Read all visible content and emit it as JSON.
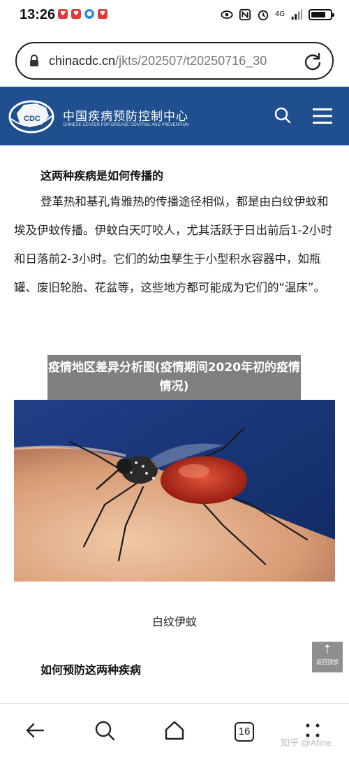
{
  "status_bar": {
    "time": "13:26",
    "network": "4G"
  },
  "browser": {
    "url_domain": "chinacdc.cn",
    "url_path": "/jkts/202507/t20250716_30"
  },
  "site_header": {
    "logo_text": "CDC",
    "title": "中国疾病预防控制中心",
    "subtitle": "CHINESE CENTER FOR DISEASE CONTROL AND PREVENTION"
  },
  "article": {
    "heading1": "这两种疾病是如何传播的",
    "paragraph": "登革热和基孔肯雅热的传播途径相似，都是由白纹伊蚊和埃及伊蚊传播。伊蚊白天叮咬人，尤其活跃于日出前后1-2小时和日落前2-3小时。它们的幼虫孳生于小型积水容器中，如瓶罐、废旧轮胎、花盆等，这些地方都可能成为它们的“温床”。",
    "overlay": "疫情地区差异分析图(疫情期间2020年初的疫情情况)",
    "image_caption": "白纹伊蚊",
    "heading2": "如何预防这两种疾病"
  },
  "back_to_top": {
    "label": "返回顶部"
  },
  "bottom_nav": {
    "tab_count": "16"
  },
  "watermark": "知乎 @Afine"
}
